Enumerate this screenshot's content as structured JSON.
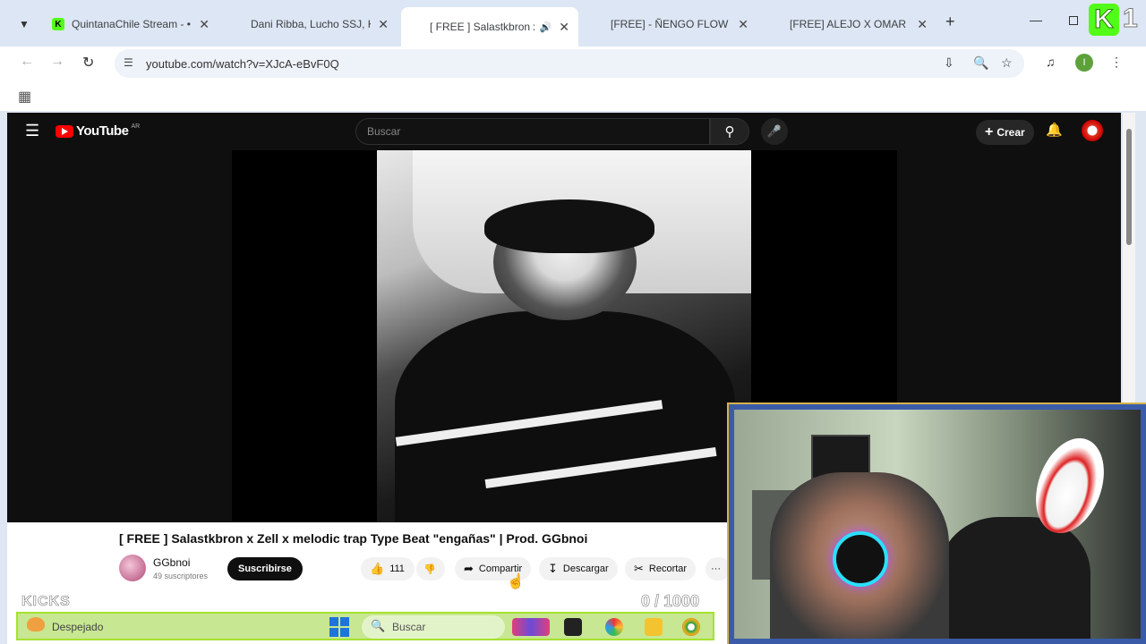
{
  "browser": {
    "tabs": [
      {
        "title": "QuintanaChile Stream - •",
        "favicon": "kick-icon"
      },
      {
        "title": "Dani Ribba, Lucho SSJ, Ki",
        "favicon": "youtube-icon"
      },
      {
        "title": "[ FREE ] Salastkbron x",
        "favicon": "youtube-icon",
        "active": true,
        "audio": true
      },
      {
        "title": "[FREE] - ÑENGO FLOW X",
        "favicon": "youtube-icon"
      },
      {
        "title": "[FREE] ALEJO X OMAR C",
        "favicon": "youtube-icon"
      }
    ],
    "url": "youtube.com/watch?v=XJcA-eBvF0Q",
    "profile_initial": "I"
  },
  "overlay": {
    "kick_letter": "K",
    "kick_count": "1",
    "kicks_label": "KICKS",
    "goal_label": "0 / 1000"
  },
  "youtube": {
    "logo_text": "YouTube",
    "country_code": "AR",
    "search_placeholder": "Buscar",
    "create_label": "Crear",
    "video_title": "[ FREE ] Salastkbron x Zell x melodic trap Type Beat \"engañas\" | Prod. GGbnoi",
    "channel_name": "GGbnoi",
    "channel_subs": "49 suscriptores",
    "subscribe_label": "Suscribirse",
    "likes": "111",
    "share_label": "Compartir",
    "download_label": "Descargar",
    "clip_label": "Recortar",
    "more_label": "···"
  },
  "taskbar": {
    "weather": "Despejado",
    "search_placeholder": "Buscar"
  },
  "colors": {
    "kick_green": "#53fc18",
    "youtube_red": "#ff0000",
    "taskbar_bg": "#c4e68c"
  }
}
